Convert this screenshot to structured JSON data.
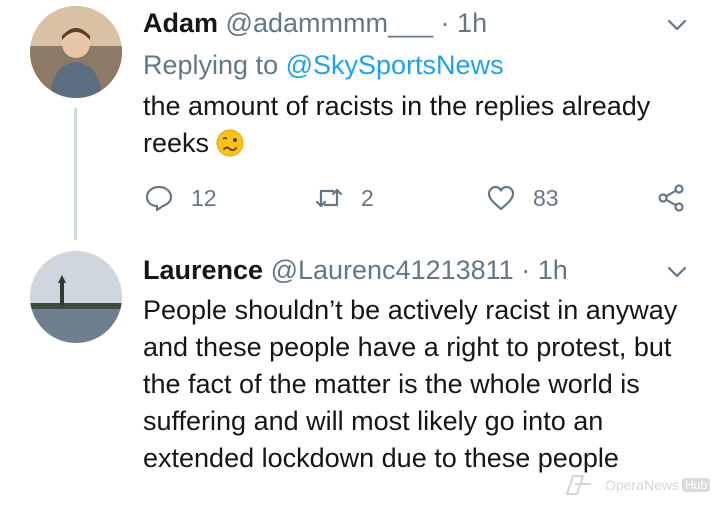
{
  "tweets": [
    {
      "name": "Adam",
      "handle": "@adammmm___",
      "separator": "·",
      "time": "1h",
      "reply_prefix": "Replying to",
      "reply_to": "@SkySportsNews",
      "text": "the amount of racists in the replies already reeks",
      "emoji": "woozy-face-icon",
      "actions": {
        "replies": "12",
        "retweets": "2",
        "likes": "83"
      }
    },
    {
      "name": "Laurence",
      "handle": "@Laurenc41213811",
      "separator": "·",
      "time": "1h",
      "text": "People shouldn’t be actively racist in anyway and these people have a right to protest, but the fact of the matter is the whole world is suffering and will most likely go into an extended lockdown due to these people"
    }
  ],
  "watermark": {
    "brand": "OperaNews",
    "badge": "Hub"
  },
  "colors": {
    "text": "#14171a",
    "secondary": "#657786",
    "link": "#1da1f2",
    "thread_line": "#cfd9de"
  }
}
